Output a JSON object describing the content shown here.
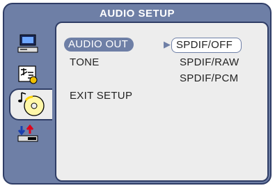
{
  "header": {
    "title": "AUDIO SETUP"
  },
  "sidebar": {
    "items": [
      {
        "icon": "monitor-icon"
      },
      {
        "icon": "language-icon"
      },
      {
        "icon": "audio-disc-icon",
        "active": true
      },
      {
        "icon": "preferences-icon"
      }
    ]
  },
  "menu": {
    "items": [
      {
        "label": "AUDIO OUT",
        "selected": true
      },
      {
        "label": "TONE"
      },
      {
        "label": "EXIT SETUP"
      }
    ]
  },
  "options": {
    "items": [
      {
        "label": "SPDIF/OFF",
        "selected": true
      },
      {
        "label": "SPDIF/RAW"
      },
      {
        "label": "SPDIF/PCM"
      }
    ]
  },
  "colors": {
    "frame": "#6e7fa6",
    "border": "#2f3d66",
    "panel": "#ededed"
  }
}
